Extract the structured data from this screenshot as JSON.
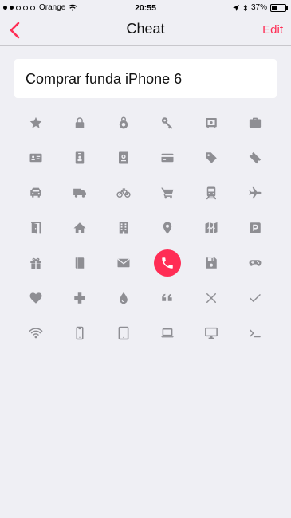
{
  "status_bar": {
    "carrier": "Orange",
    "time": "20:55",
    "battery": "37%",
    "signal_bars_filled": 2,
    "signal_bars_total": 5,
    "battery_level": 0.37
  },
  "nav": {
    "title": "Cheat",
    "edit_label": "Edit"
  },
  "card": {
    "title": "Comprar funda iPhone 6"
  },
  "accent_color": "#ff2d55",
  "icon_color": "#8e8e93",
  "icons": [
    [
      "star-icon",
      "lock-icon",
      "combination-lock-icon",
      "key-icon",
      "safe-icon",
      "briefcase-icon"
    ],
    [
      "id-card-icon",
      "id-badge-icon",
      "passport-icon",
      "credit-card-icon",
      "tag-icon",
      "ticket-icon"
    ],
    [
      "car-icon",
      "truck-icon",
      "bicycle-icon",
      "shopping-cart-icon",
      "train-icon",
      "airplane-icon"
    ],
    [
      "door-icon",
      "home-icon",
      "building-icon",
      "location-pin-icon",
      "map-icon",
      "parking-icon"
    ],
    [
      "gift-icon",
      "book-icon",
      "envelope-icon",
      "phone-icon",
      "floppy-disk-icon",
      "gamepad-icon"
    ],
    [
      "heart-icon",
      "medical-cross-icon",
      "drop-icon",
      "quote-icon",
      "x-mark-icon",
      "checkmark-icon"
    ],
    [
      "wifi-icon",
      "smartphone-icon",
      "tablet-icon",
      "laptop-icon",
      "monitor-icon",
      "terminal-icon"
    ]
  ],
  "selected_icon": "phone-icon"
}
